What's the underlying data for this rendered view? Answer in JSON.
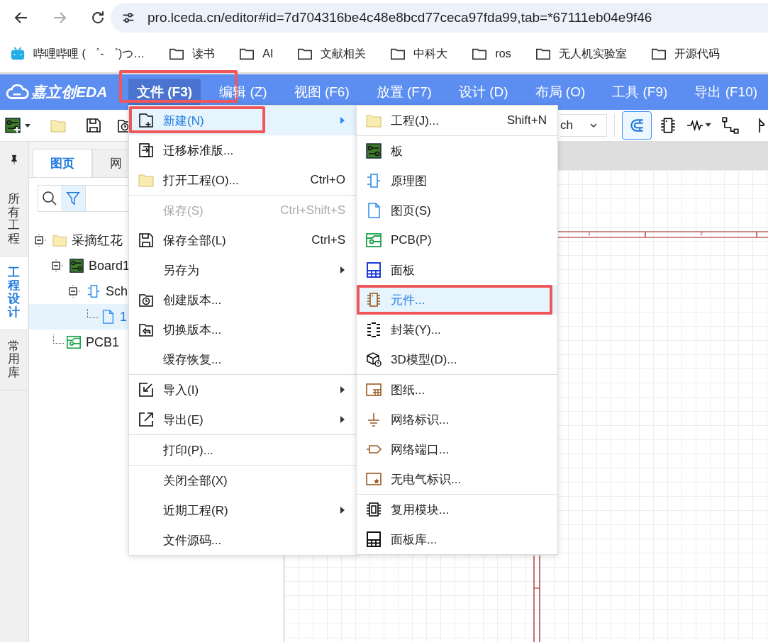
{
  "browser": {
    "url": "pro.lceda.cn/editor#id=7d704316be4c48e8bcd77ceca97fda99,tab=*67111eb04e9f46",
    "bookmarks": [
      {
        "label": "哔哩哔哩 ( ゜- ゜)つ…",
        "kind": "app"
      },
      {
        "label": "读书",
        "kind": "folder"
      },
      {
        "label": "AI",
        "kind": "folder"
      },
      {
        "label": "文献相关",
        "kind": "folder"
      },
      {
        "label": "中科大",
        "kind": "folder"
      },
      {
        "label": "ros",
        "kind": "folder"
      },
      {
        "label": "无人机实验室",
        "kind": "folder"
      },
      {
        "label": "开源代码",
        "kind": "folder"
      }
    ]
  },
  "app": {
    "logo": "嘉立创EDA",
    "menubar": [
      {
        "label": "文件 (F3)",
        "selected": true,
        "highlighted": true
      },
      {
        "label": "编辑 (Z)",
        "selected": false,
        "highlighted": false
      },
      {
        "label": "视图 (F6)",
        "selected": false,
        "highlighted": false
      },
      {
        "label": "放置 (F7)",
        "selected": false,
        "highlighted": false
      },
      {
        "label": "设计 (D)",
        "selected": false,
        "highlighted": false
      },
      {
        "label": "布局 (O)",
        "selected": false,
        "highlighted": false
      },
      {
        "label": "工具 (F9)",
        "selected": false,
        "highlighted": false
      },
      {
        "label": "导出 (F10)",
        "selected": false,
        "highlighted": false
      }
    ]
  },
  "toolbar": {
    "select_value": "ch",
    "tools": [
      {
        "selected": true
      },
      {
        "selected": false
      },
      {
        "selected": false
      },
      {
        "selected": false
      },
      {
        "selected": false
      }
    ]
  },
  "side_tabs": [
    {
      "label": "所有工程",
      "selected": false
    },
    {
      "label": "工程设计",
      "selected": true
    },
    {
      "label": "常用库",
      "selected": false
    }
  ],
  "left_panel": {
    "tabs": [
      {
        "label": "图页",
        "selected": true
      },
      {
        "label": "网",
        "selected": false
      }
    ],
    "filter_on": true,
    "tree": [
      {
        "label": "采摘红花",
        "kind": "project",
        "expanded": true,
        "selected": false,
        "children": [
          {
            "label": "Board1",
            "kind": "board",
            "expanded": true,
            "selected": false,
            "children": [
              {
                "label": "Sch",
                "kind": "schematic",
                "expanded": true,
                "selected": false,
                "children": [
                  {
                    "label": "1",
                    "kind": "page",
                    "selected": true
                  }
                ]
              }
            ]
          },
          {
            "label": "PCB1",
            "kind": "pcb",
            "selected": false
          }
        ]
      }
    ]
  },
  "canvas": {
    "frame_labels": [
      "1",
      "2"
    ]
  },
  "file_menu": {
    "items": [
      {
        "label": "新建(N)",
        "submenu": true,
        "selected": true,
        "highlighted": true,
        "disabled": false
      },
      {
        "label": "迁移标准版...",
        "submenu": false,
        "selected": false,
        "highlighted": false,
        "disabled": false
      },
      {
        "label": "打开工程(O)...",
        "shortcut": "Ctrl+O",
        "submenu": false,
        "selected": false,
        "highlighted": false,
        "disabled": false,
        "separator_after": true
      },
      {
        "label": "保存(S)",
        "shortcut": "Ctrl+Shift+S",
        "submenu": false,
        "selected": false,
        "highlighted": false,
        "disabled": true
      },
      {
        "label": "保存全部(L)",
        "shortcut": "Ctrl+S",
        "submenu": false,
        "selected": false,
        "highlighted": false,
        "disabled": false
      },
      {
        "label": "另存为",
        "submenu": true,
        "selected": false,
        "highlighted": false,
        "disabled": false
      },
      {
        "label": "创建版本...",
        "submenu": false,
        "selected": false,
        "highlighted": false,
        "disabled": false
      },
      {
        "label": "切换版本...",
        "submenu": false,
        "selected": false,
        "highlighted": false,
        "disabled": false
      },
      {
        "label": "缓存恢复...",
        "submenu": false,
        "selected": false,
        "highlighted": false,
        "disabled": false,
        "separator_after": true
      },
      {
        "label": "导入(I)",
        "submenu": true,
        "selected": false,
        "highlighted": false,
        "disabled": false
      },
      {
        "label": "导出(E)",
        "submenu": true,
        "selected": false,
        "highlighted": false,
        "disabled": false,
        "separator_after": true
      },
      {
        "label": "打印(P)...",
        "submenu": false,
        "selected": false,
        "highlighted": false,
        "disabled": false,
        "separator_after": true
      },
      {
        "label": "关闭全部(X)",
        "submenu": false,
        "selected": false,
        "highlighted": false,
        "disabled": false
      },
      {
        "label": "近期工程(R)",
        "submenu": true,
        "selected": false,
        "highlighted": false,
        "disabled": false
      },
      {
        "label": "文件源码...",
        "submenu": false,
        "selected": false,
        "highlighted": false,
        "disabled": false
      }
    ]
  },
  "new_submenu": {
    "items": [
      {
        "label": "工程(J)...",
        "shortcut": "Shift+N",
        "selected": false,
        "highlighted": false,
        "separator_after": true
      },
      {
        "label": "板",
        "selected": false,
        "highlighted": false
      },
      {
        "label": "原理图",
        "selected": false,
        "highlighted": false
      },
      {
        "label": "图页(S)",
        "selected": false,
        "highlighted": false
      },
      {
        "label": "PCB(P)",
        "selected": false,
        "highlighted": false
      },
      {
        "label": "面板",
        "selected": false,
        "highlighted": false
      },
      {
        "label": "元件...",
        "selected": true,
        "highlighted": true
      },
      {
        "label": "封装(Y)...",
        "selected": false,
        "highlighted": false
      },
      {
        "label": "3D模型(D)...",
        "selected": false,
        "highlighted": false,
        "separator_after": true
      },
      {
        "label": "图纸...",
        "selected": false,
        "highlighted": false
      },
      {
        "label": "网络标识...",
        "selected": false,
        "highlighted": false
      },
      {
        "label": "网络端口...",
        "selected": false,
        "highlighted": false
      },
      {
        "label": "无电气标识...",
        "selected": false,
        "highlighted": false,
        "separator_after": true
      },
      {
        "label": "复用模块...",
        "selected": false,
        "highlighted": false
      },
      {
        "label": "面板库...",
        "selected": false,
        "highlighted": false
      }
    ]
  }
}
